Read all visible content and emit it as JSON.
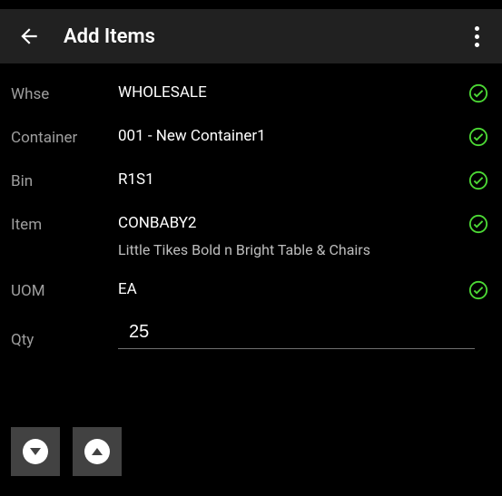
{
  "header": {
    "title": "Add Items"
  },
  "fields": {
    "whse": {
      "label": "Whse",
      "value": "WHOLESALE"
    },
    "container": {
      "label": "Container",
      "value": "001 - New Container1"
    },
    "bin": {
      "label": "Bin",
      "value": "R1S1"
    },
    "item": {
      "label": "Item",
      "value": "CONBABY2",
      "desc": "Little Tikes Bold n Bright Table & Chairs"
    },
    "uom": {
      "label": "UOM",
      "value": "EA"
    },
    "qty": {
      "label": "Qty",
      "value": "25"
    }
  }
}
